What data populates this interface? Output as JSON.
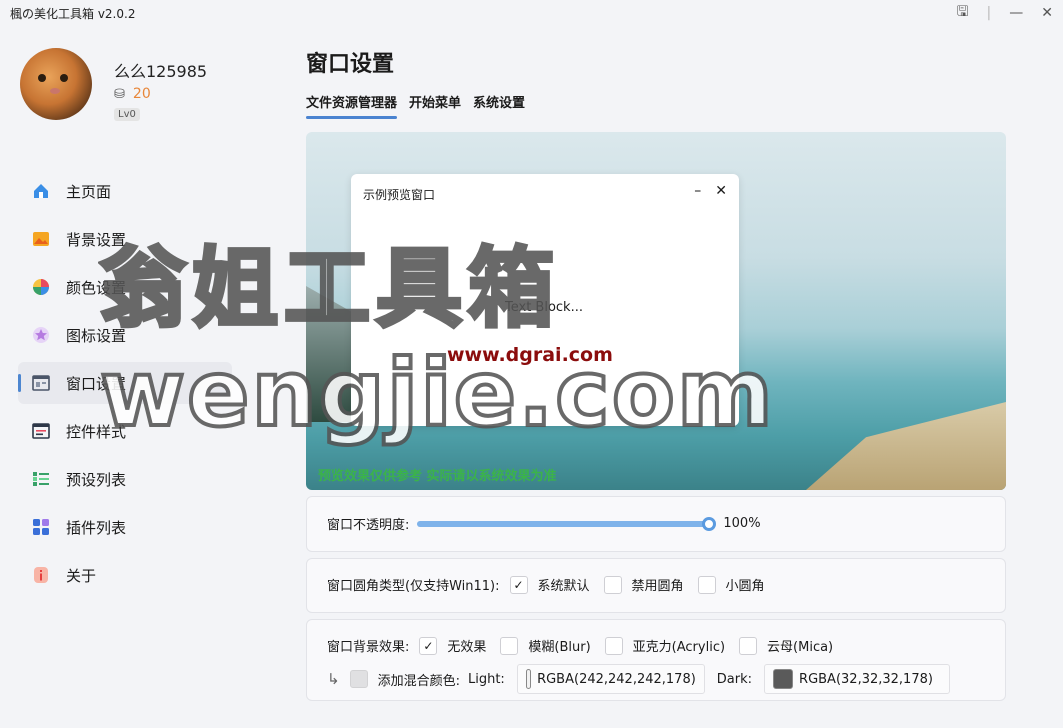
{
  "window": {
    "title": "楓の美化工具箱 v2.0.2",
    "controls": {
      "save": "🖫",
      "minimize": "—",
      "close": "✕"
    }
  },
  "profile": {
    "username": "么么125985",
    "coins": "20",
    "level": "Lv0"
  },
  "nav": [
    {
      "label": "主页面",
      "icon": "home-icon",
      "color": "#3a8ee6"
    },
    {
      "label": "背景设置",
      "icon": "image-icon",
      "color": "#f08a24"
    },
    {
      "label": "颜色设置",
      "icon": "palette-icon",
      "color": "#e84a5f"
    },
    {
      "label": "图标设置",
      "icon": "star-icon",
      "color": "#b57be0"
    },
    {
      "label": "窗口设置",
      "icon": "window-icon",
      "color": "#4a5568"
    },
    {
      "label": "控件样式",
      "icon": "control-icon",
      "color": "#2d3748"
    },
    {
      "label": "预设列表",
      "icon": "list-icon",
      "color": "#38a169"
    },
    {
      "label": "插件列表",
      "icon": "grid-icon",
      "color": "#3a6fd8"
    },
    {
      "label": "关于",
      "icon": "info-icon",
      "color": "#f56565"
    }
  ],
  "page": {
    "title": "窗口设置",
    "tabs": [
      "文件资源管理器",
      "开始菜单",
      "系统设置"
    ]
  },
  "preview": {
    "window_title": "示例预览窗口",
    "text_block": "Text Block...",
    "note": "预览效果仅供参考 实际请以系统效果为准"
  },
  "opacity": {
    "label": "窗口不透明度:",
    "value_text": "100%",
    "value": 1.0
  },
  "corner": {
    "label": "窗口圆角类型(仅支持Win11):",
    "options": [
      "系统默认",
      "禁用圆角",
      "小圆角"
    ],
    "selected": 0
  },
  "effect": {
    "label": "窗口背景效果:",
    "options": [
      "无效果",
      "模糊(Blur)",
      "亚克力(Acrylic)",
      "云母(Mica)"
    ],
    "selected": 0,
    "blend_label": "添加混合颜色:",
    "light_label": "Light:",
    "light_value": "RGBA(242,242,242,178)",
    "light_color": "#f2f2f2",
    "dark_label": "Dark:",
    "dark_value": "RGBA(32,32,32,178)",
    "dark_color": "#5a5a5a"
  },
  "watermark": {
    "line1": "翁姐工具箱",
    "line2": "wengjie.com",
    "url": "www.dgrai.com"
  }
}
